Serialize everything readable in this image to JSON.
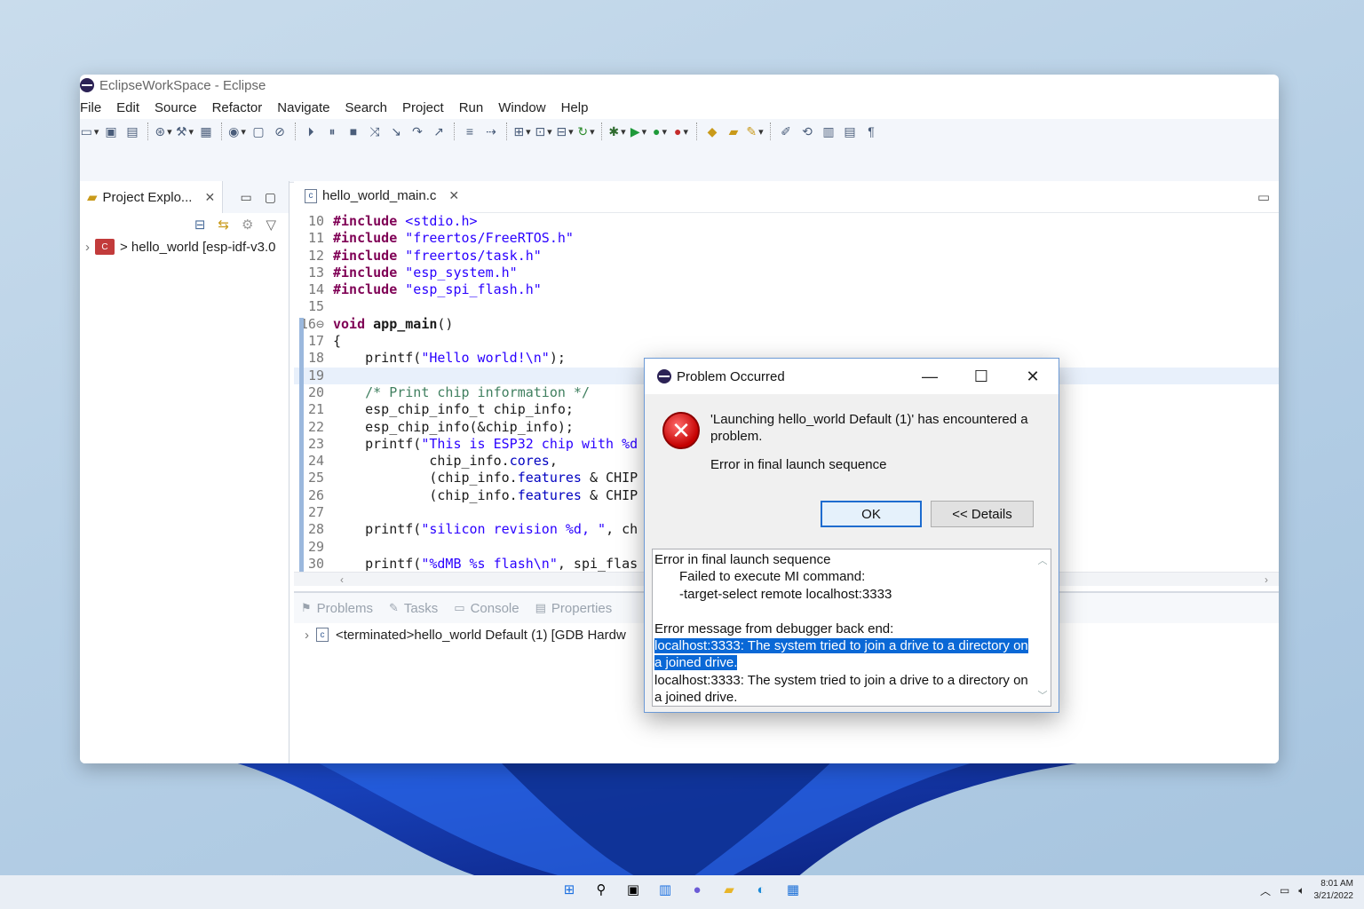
{
  "window": {
    "title": "EclipseWorkSpace - Eclipse",
    "menu": [
      "File",
      "Edit",
      "Source",
      "Refactor",
      "Navigate",
      "Search",
      "Project",
      "Run",
      "Window",
      "Help"
    ]
  },
  "project_explorer": {
    "tab_label": "Project Explo...",
    "tree_item": "> hello_world [esp-idf-v3.0"
  },
  "editor": {
    "tab_label": "hello_world_main.c",
    "lines": [
      {
        "n": "10",
        "html": "<span class='kw'>#include</span> <span class='str'>&lt;stdio.h&gt;</span>"
      },
      {
        "n": "11",
        "html": "<span class='kw'>#include</span> <span class='str'>\"freertos/FreeRTOS.h\"</span>"
      },
      {
        "n": "12",
        "html": "<span class='kw'>#include</span> <span class='str'>\"freertos/task.h\"</span>"
      },
      {
        "n": "13",
        "html": "<span class='kw'>#include</span> <span class='str'>\"esp_system.h\"</span>"
      },
      {
        "n": "14",
        "html": "<span class='kw'>#include</span> <span class='str'>\"esp_spi_flash.h\"</span>"
      },
      {
        "n": "15",
        "html": ""
      },
      {
        "n": "16⊖",
        "html": "<span class='kw'>void</span> <b>app_main</b>()"
      },
      {
        "n": "17",
        "html": "{"
      },
      {
        "n": "18",
        "html": "    printf(<span class='str'>\"Hello world!\\n\"</span>);"
      },
      {
        "n": "19",
        "html": "",
        "hl": true
      },
      {
        "n": "20",
        "html": "    <span class='cmt'>/* Print chip information */</span>"
      },
      {
        "n": "21",
        "html": "    esp_chip_info_t chip_info;"
      },
      {
        "n": "22",
        "html": "    esp_chip_info(&amp;chip_info);"
      },
      {
        "n": "23",
        "html": "    printf(<span class='str'>\"This is ESP32 chip with %d</span>"
      },
      {
        "n": "24",
        "html": "            chip_info.<span class='fld'>cores</span>,"
      },
      {
        "n": "25",
        "html": "            (chip_info.<span class='fld'>features</span> &amp; CHIP"
      },
      {
        "n": "26",
        "html": "            (chip_info.<span class='fld'>features</span> &amp; CHIP"
      },
      {
        "n": "27",
        "html": ""
      },
      {
        "n": "28",
        "html": "    printf(<span class='str'>\"silicon revision %d, \"</span>, ch"
      },
      {
        "n": "29",
        "html": ""
      },
      {
        "n": "30",
        "html": "    printf(<span class='str'>\"%dMB %s flash\\n\"</span>, spi_flas"
      }
    ]
  },
  "bottom_panel": {
    "tabs": [
      "Problems",
      "Tasks",
      "Console",
      "Properties"
    ],
    "console_line": "<terminated>hello_world Default (1) [GDB Hardw"
  },
  "dialog": {
    "title": "Problem Occurred",
    "message": "'Launching hello_world Default (1)' has encountered a problem.",
    "sub": "Error in final launch sequence",
    "ok_label": "OK",
    "details_label": "<< Details",
    "details": {
      "l1": "Error in final launch sequence",
      "l2": "Failed to execute MI command:",
      "l3": "-target-select remote localhost:3333",
      "l4": "Error message from debugger back end:",
      "l5": "localhost:3333: The system tried to join a drive to a directory on a joined drive.",
      "l6": "localhost:3333: The system tried to join a drive to a directory on a joined drive."
    }
  },
  "taskbar": {
    "time": "8:01 AM",
    "date": "3/21/2022"
  },
  "colors": {
    "selection": "#0a68d6",
    "keyword": "#7f0055",
    "string": "#2a00ff"
  }
}
